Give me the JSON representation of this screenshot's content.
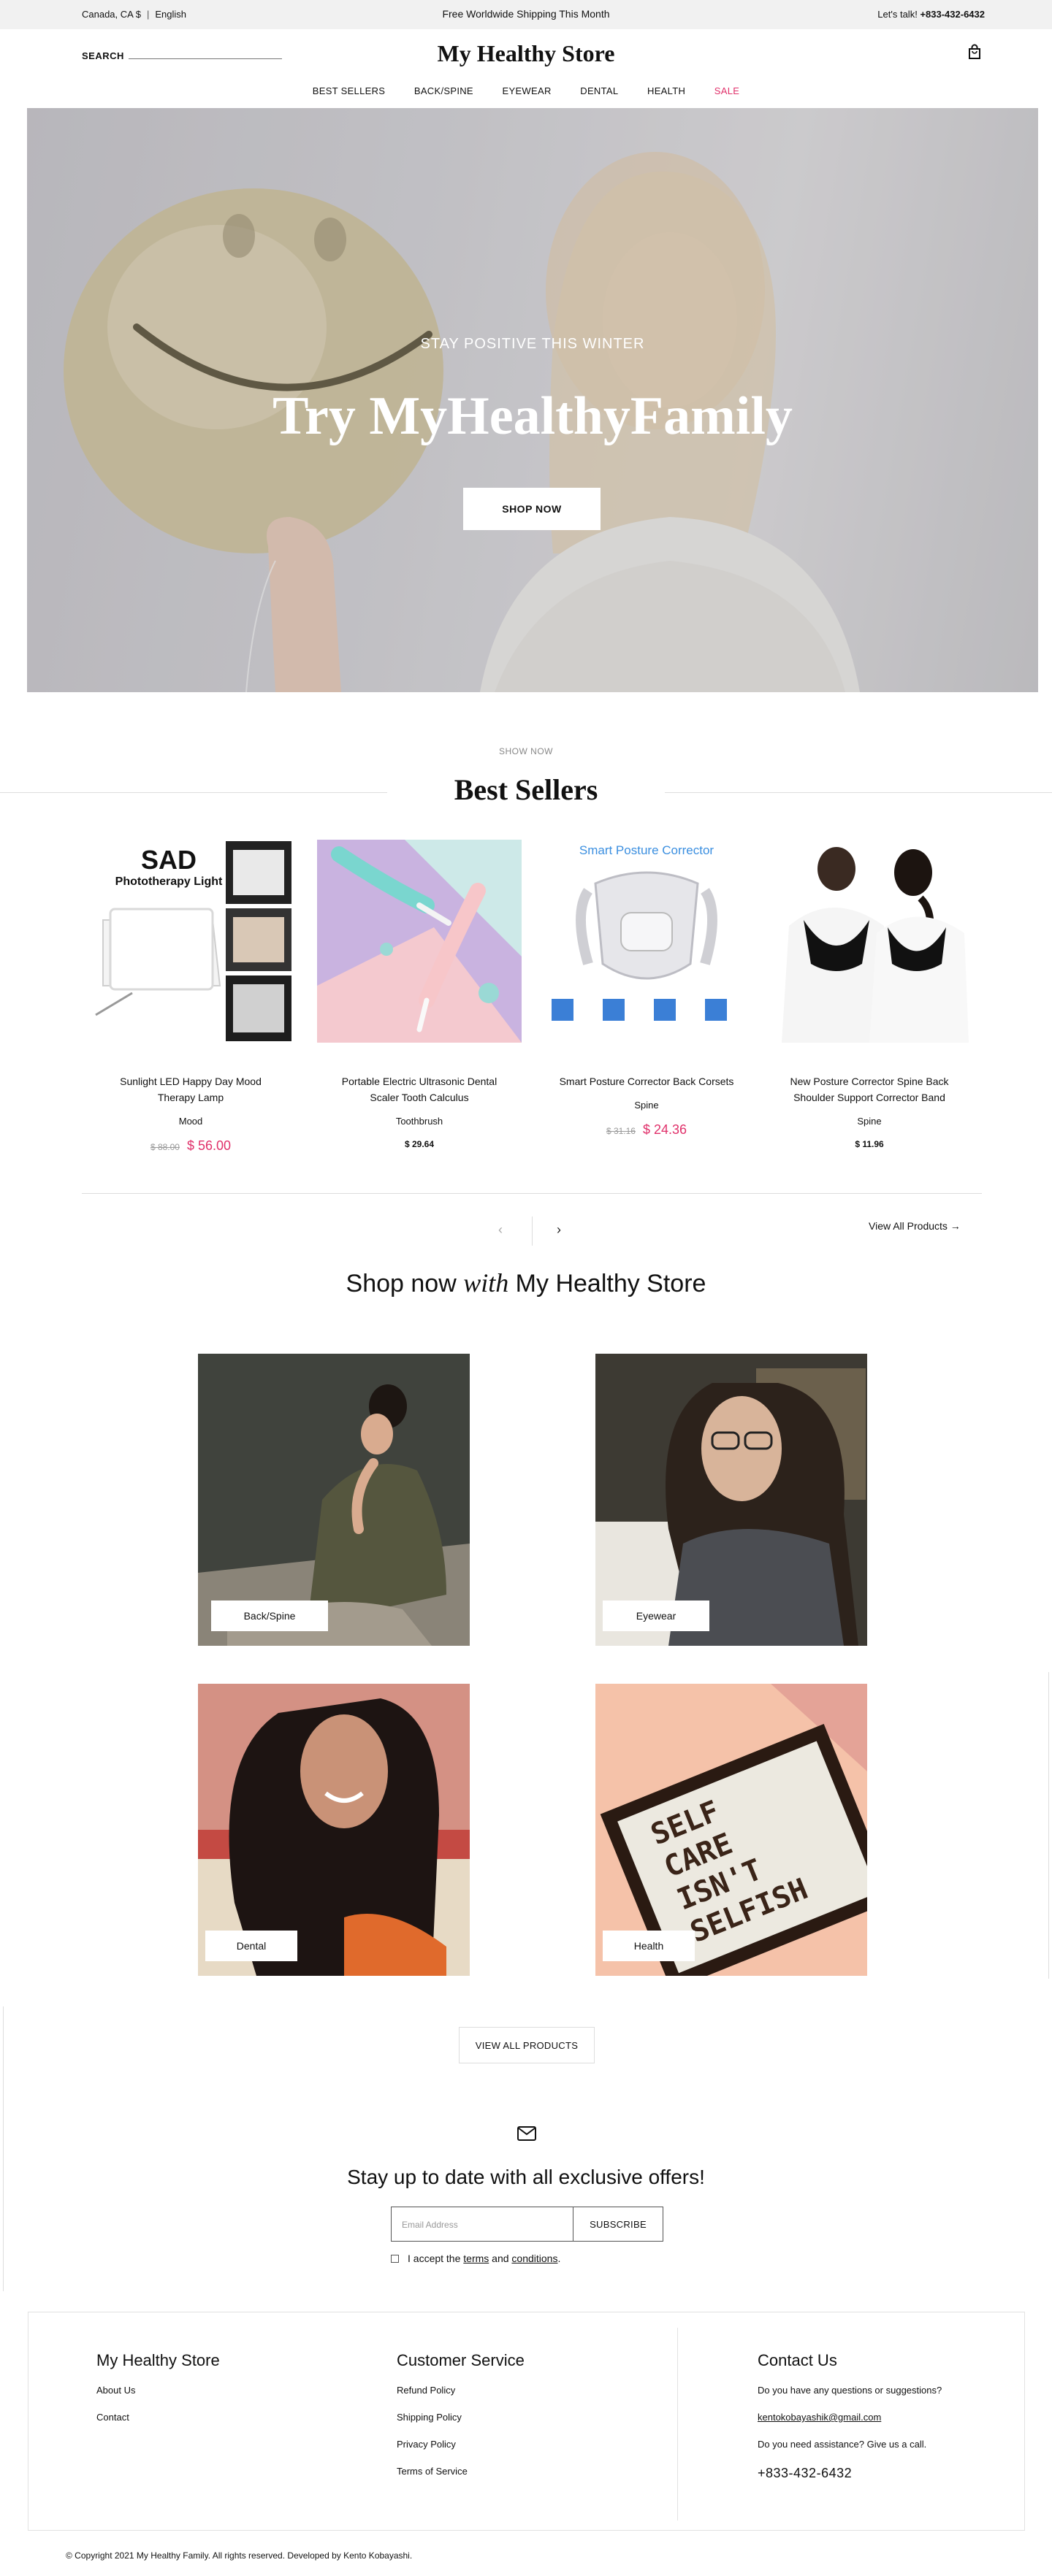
{
  "topbar": {
    "locale": "Canada, CA $",
    "language": "English",
    "promo": "Free Worldwide Shipping This Month",
    "talk_label": "Let's talk!",
    "phone": "+833-432-6432"
  },
  "header": {
    "search_label": "SEARCH",
    "logo": "My Healthy Store",
    "cart_icon": "shopping-bag-icon"
  },
  "nav": {
    "items": [
      "BEST SELLERS",
      "BACK/SPINE",
      "EYEWEAR",
      "DENTAL",
      "HEALTH",
      "SALE"
    ],
    "sale_color": "#e0306a"
  },
  "hero": {
    "tagline": "STAY POSITIVE THIS WINTER",
    "title": "Try MyHealthyFamily",
    "button": "SHOP NOW"
  },
  "best_sellers": {
    "eyebrow": "SHOW NOW",
    "title": "Best Sellers",
    "products": [
      {
        "name": "Sunlight LED Happy Day Mood Therapy Lamp",
        "category": "Mood",
        "old_price": "$ 88.00",
        "price": "$ 56.00",
        "image_text_1": "SAD",
        "image_text_2": "Phototherapy Light"
      },
      {
        "name": "Portable Electric Ultrasonic Dental Scaler Tooth Calculus",
        "category": "Toothbrush",
        "price": "$ 29.64"
      },
      {
        "name": "Smart Posture Corrector Back Corsets",
        "category": "Spine",
        "old_price": "$ 31.16",
        "price": "$ 24.36",
        "image_text_1": "Smart Posture Corrector"
      },
      {
        "name": "New Posture Corrector Spine Back Shoulder Support Corrector Band",
        "category": "Spine",
        "price": "$ 11.96"
      }
    ],
    "prev_arrow": "‹",
    "next_arrow": "›",
    "view_all": "View All Products →"
  },
  "shop_with": {
    "before": "Shop now ",
    "italic": "with",
    "after": " My Healthy Store"
  },
  "categories": [
    {
      "label": "Back/Spine"
    },
    {
      "label": "Eyewear"
    },
    {
      "label": "Dental"
    },
    {
      "label": "Health"
    }
  ],
  "health_sign": [
    "SELF",
    "CARE",
    "ISN'T",
    "SELFISH"
  ],
  "view_all_button": "VIEW ALL PRODUCTS",
  "newsletter": {
    "icon": "envelope-icon",
    "title": "Stay up to date with all exclusive offers!",
    "email_placeholder": "Email Address",
    "subscribe": "SUBSCRIBE",
    "accept_prefix": "I accept the ",
    "terms": "terms",
    "and": " and ",
    "conditions": "conditions",
    "period": "."
  },
  "footer": {
    "col1": {
      "title": "My Healthy Store",
      "links": [
        "About Us",
        "Contact"
      ]
    },
    "col2": {
      "title": "Customer Service",
      "links": [
        "Refund Policy",
        "Shipping Policy",
        "Privacy Policy",
        "Terms of Service"
      ]
    },
    "col3": {
      "title": "Contact Us",
      "question": "Do you have any questions or suggestions?",
      "email": "kentokobayashik@gmail.com",
      "assist": "Do you need assistance? Give us a call.",
      "phone": "+833-432-6432"
    },
    "copyright": "© Copyright 2021 My Healthy Family. All rights reserved. Developed by Kento Kobayashi."
  }
}
